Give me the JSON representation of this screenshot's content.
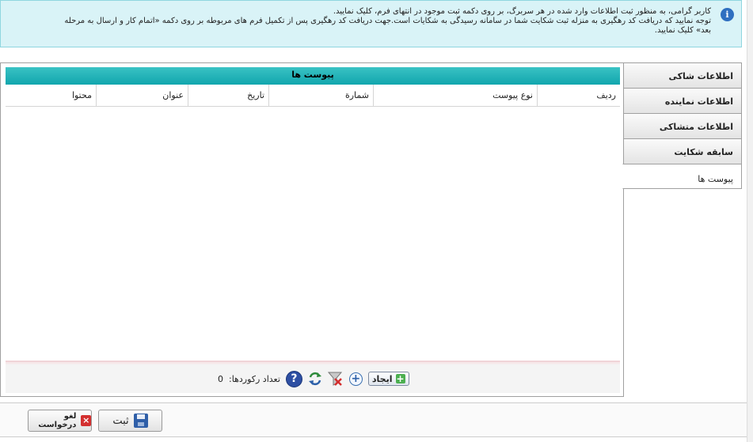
{
  "info": {
    "line1": "کاربر گرامی، به منظور ثبت اطلاعات وارد شده در هر سربرگ، بر روی دکمه ثبت موجود در انتهای فرم، کلیک نمایید.",
    "line2": "توجه نمایید که دریافت کد رهگیری به منزله ثبت شکایت شما در سامانه رسیدگی به شکایات است.جهت دریافت کد رهگیری پس از تکمیل فرم های مربوطه بر روی دکمه «اتمام کار و ارسال به مرحله",
    "line3": "بعد» کلیک نمایید."
  },
  "grid": {
    "title": "پیوست ها",
    "columns": [
      "ردیف",
      "نوع پیوست",
      "شمارة",
      "تاریخ",
      "عنوان",
      "محتوا"
    ]
  },
  "footer": {
    "create_label": "ایجاد",
    "record_label": "تعداد رکوردها:",
    "record_count": "0",
    "help_glyph": "?"
  },
  "tabs": [
    {
      "label": "اطلاعات شاکی"
    },
    {
      "label": "اطلاعات نماینده"
    },
    {
      "label": "اطلاعات متشاکی"
    },
    {
      "label": "سابقه شکایت"
    },
    {
      "label": "پیوست ها"
    }
  ],
  "buttons": {
    "save_label": "ثبت",
    "cancel_label": "لغو درخواست"
  },
  "colors": {
    "title_bar": "#12a6ae",
    "info_bg": "#d9f3f7"
  }
}
